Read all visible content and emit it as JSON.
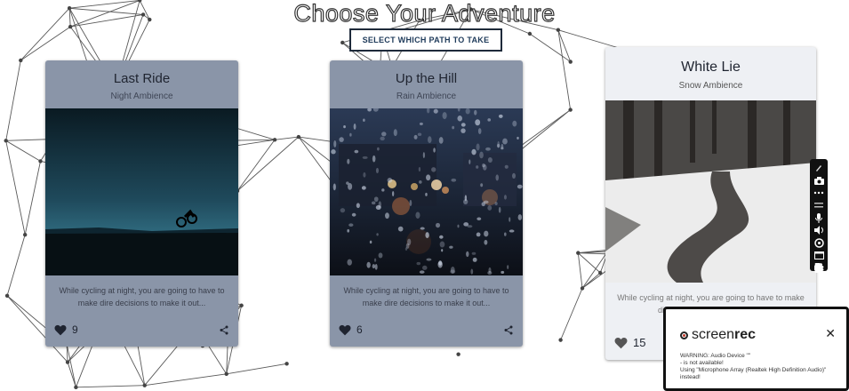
{
  "header": {
    "title": "Choose Your Adventure",
    "cta_label": "SELECT WHICH PATH TO TAKE"
  },
  "cards": [
    {
      "title": "Last Ride",
      "subtitle": "Night Ambience",
      "description": "While cycling at night, you are going to have to make dire decisions to make it out...",
      "likes": "9",
      "image": "night-cyclist-photo"
    },
    {
      "title": "Up the Hill",
      "subtitle": "Rain Ambience",
      "description": "While cycling at night, you are going to have to make dire decisions to make it out...",
      "likes": "6",
      "image": "rainy-window-photo"
    },
    {
      "title": "White Lie",
      "subtitle": "Snow Ambience",
      "description": "While cycling at night, you are going to have to make dire decisions to make it out...",
      "likes": "15",
      "image": "snowy-forest-stream-photo"
    }
  ],
  "recorder_popup": {
    "brand_prefix": "screen",
    "brand_suffix": "rec",
    "warning_line1": "WARNING: Audio Device \"\"",
    "warning_line2": "- is not available!",
    "warning_line3": "Using \"Microphone Array (Realtek High Definition Audio)\" instead!"
  },
  "recorder_toolbar": {
    "icons": [
      "pen-icon",
      "camera-icon",
      "dots-icon",
      "microphone-icon",
      "speaker-icon",
      "webcam-icon",
      "window-icon",
      "settings-icon"
    ]
  },
  "colors": {
    "card": "#8a95a8",
    "card_active": "#eef0f4",
    "title_stroke": "#333333",
    "cta_border": "#1e2a3a"
  }
}
